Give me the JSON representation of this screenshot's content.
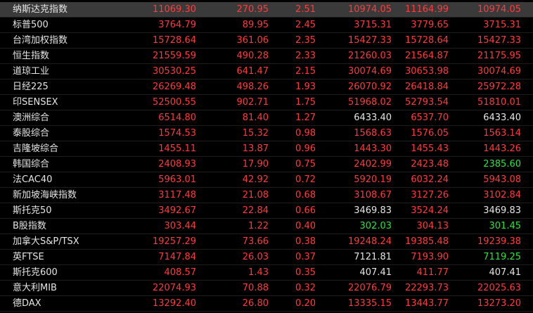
{
  "colors": {
    "up": "#ff3b3b",
    "down": "#33e040",
    "flat": "#e4e4e4",
    "name_text": "#e4e4e4",
    "background": "#000000",
    "selected_row": "#3a3a3a"
  },
  "selected_index": 0,
  "rows": [
    {
      "name": "纳斯达克指数",
      "price": "11069.30",
      "change": "270.95",
      "pct": "2.51",
      "open": "10974.05",
      "high": "11164.99",
      "low": "10974.05",
      "colors": [
        "up",
        "up",
        "up",
        "up",
        "up",
        "up"
      ]
    },
    {
      "name": "标普500",
      "price": "3764.79",
      "change": "89.95",
      "pct": "2.45",
      "open": "3715.31",
      "high": "3779.65",
      "low": "3715.31",
      "colors": [
        "up",
        "up",
        "up",
        "up",
        "up",
        "up"
      ]
    },
    {
      "name": "台湾加权指数",
      "price": "15728.64",
      "change": "361.06",
      "pct": "2.35",
      "open": "15427.33",
      "high": "15728.64",
      "low": "15427.33",
      "colors": [
        "up",
        "up",
        "up",
        "up",
        "up",
        "up"
      ]
    },
    {
      "name": "恒生指数",
      "price": "21559.59",
      "change": "490.28",
      "pct": "2.33",
      "open": "21260.03",
      "high": "21564.87",
      "low": "21175.95",
      "colors": [
        "up",
        "up",
        "up",
        "up",
        "up",
        "up"
      ]
    },
    {
      "name": "道琼工业",
      "price": "30530.25",
      "change": "641.47",
      "pct": "2.15",
      "open": "30074.69",
      "high": "30653.98",
      "low": "30074.69",
      "colors": [
        "up",
        "up",
        "up",
        "up",
        "up",
        "up"
      ]
    },
    {
      "name": "日经225",
      "price": "26269.48",
      "change": "498.26",
      "pct": "1.93",
      "open": "26070.92",
      "high": "26418.84",
      "low": "25972.28",
      "colors": [
        "up",
        "up",
        "up",
        "up",
        "up",
        "up"
      ]
    },
    {
      "name": "印SENSEX",
      "price": "52500.55",
      "change": "902.71",
      "pct": "1.75",
      "open": "51968.02",
      "high": "52793.54",
      "low": "51810.01",
      "colors": [
        "up",
        "up",
        "up",
        "up",
        "up",
        "up"
      ]
    },
    {
      "name": "澳洲综合",
      "price": "6514.80",
      "change": "81.40",
      "pct": "1.27",
      "open": "6433.40",
      "high": "6537.70",
      "low": "6433.40",
      "colors": [
        "up",
        "up",
        "up",
        "flat",
        "up",
        "flat"
      ]
    },
    {
      "name": "泰股综合",
      "price": "1574.53",
      "change": "15.32",
      "pct": "0.98",
      "open": "1568.63",
      "high": "1576.05",
      "low": "1563.14",
      "colors": [
        "up",
        "up",
        "up",
        "up",
        "up",
        "up"
      ]
    },
    {
      "name": "吉隆坡综合",
      "price": "1455.11",
      "change": "13.87",
      "pct": "0.96",
      "open": "1443.30",
      "high": "1455.43",
      "low": "1443.26",
      "colors": [
        "up",
        "up",
        "up",
        "up",
        "up",
        "up"
      ]
    },
    {
      "name": "韩国综合",
      "price": "2408.93",
      "change": "17.90",
      "pct": "0.75",
      "open": "2402.99",
      "high": "2423.48",
      "low": "2385.60",
      "colors": [
        "up",
        "up",
        "up",
        "up",
        "up",
        "down"
      ]
    },
    {
      "name": "法CAC40",
      "price": "5963.01",
      "change": "42.92",
      "pct": "0.72",
      "open": "5920.19",
      "high": "6032.24",
      "low": "5943.08",
      "colors": [
        "up",
        "up",
        "up",
        "up",
        "up",
        "up"
      ]
    },
    {
      "name": "新加坡海峡指数",
      "price": "3117.48",
      "change": "21.08",
      "pct": "0.68",
      "open": "3108.67",
      "high": "3127.26",
      "low": "3102.84",
      "colors": [
        "up",
        "up",
        "up",
        "up",
        "up",
        "up"
      ]
    },
    {
      "name": "斯托克50",
      "price": "3492.67",
      "change": "22.84",
      "pct": "0.66",
      "open": "3469.83",
      "high": "3524.24",
      "low": "3469.83",
      "colors": [
        "up",
        "up",
        "up",
        "flat",
        "up",
        "flat"
      ]
    },
    {
      "name": "B股指数",
      "price": "303.44",
      "change": "1.22",
      "pct": "0.40",
      "open": "302.03",
      "high": "304.13",
      "low": "301.45",
      "colors": [
        "up",
        "up",
        "up",
        "down",
        "up",
        "down"
      ]
    },
    {
      "name": "加拿大S&P/TSX",
      "price": "19257.29",
      "change": "73.66",
      "pct": "0.38",
      "open": "19248.24",
      "high": "19385.48",
      "low": "19239.38",
      "colors": [
        "up",
        "up",
        "up",
        "up",
        "up",
        "up"
      ]
    },
    {
      "name": "英FTSE",
      "price": "7147.84",
      "change": "26.03",
      "pct": "0.37",
      "open": "7121.81",
      "high": "7193.90",
      "low": "7119.25",
      "colors": [
        "up",
        "up",
        "up",
        "flat",
        "up",
        "down"
      ]
    },
    {
      "name": "斯托克600",
      "price": "408.57",
      "change": "1.43",
      "pct": "0.35",
      "open": "407.41",
      "high": "411.77",
      "low": "407.41",
      "colors": [
        "up",
        "up",
        "up",
        "flat",
        "up",
        "flat"
      ]
    },
    {
      "name": "意大利MIB",
      "price": "22074.93",
      "change": "70.88",
      "pct": "0.32",
      "open": "22076.79",
      "high": "22293.73",
      "low": "22025.63",
      "colors": [
        "up",
        "up",
        "up",
        "up",
        "up",
        "up"
      ]
    },
    {
      "name": "德DAX",
      "price": "13292.40",
      "change": "26.80",
      "pct": "0.20",
      "open": "13335.15",
      "high": "13443.77",
      "low": "13273.20",
      "colors": [
        "up",
        "up",
        "up",
        "up",
        "up",
        "up"
      ]
    }
  ]
}
